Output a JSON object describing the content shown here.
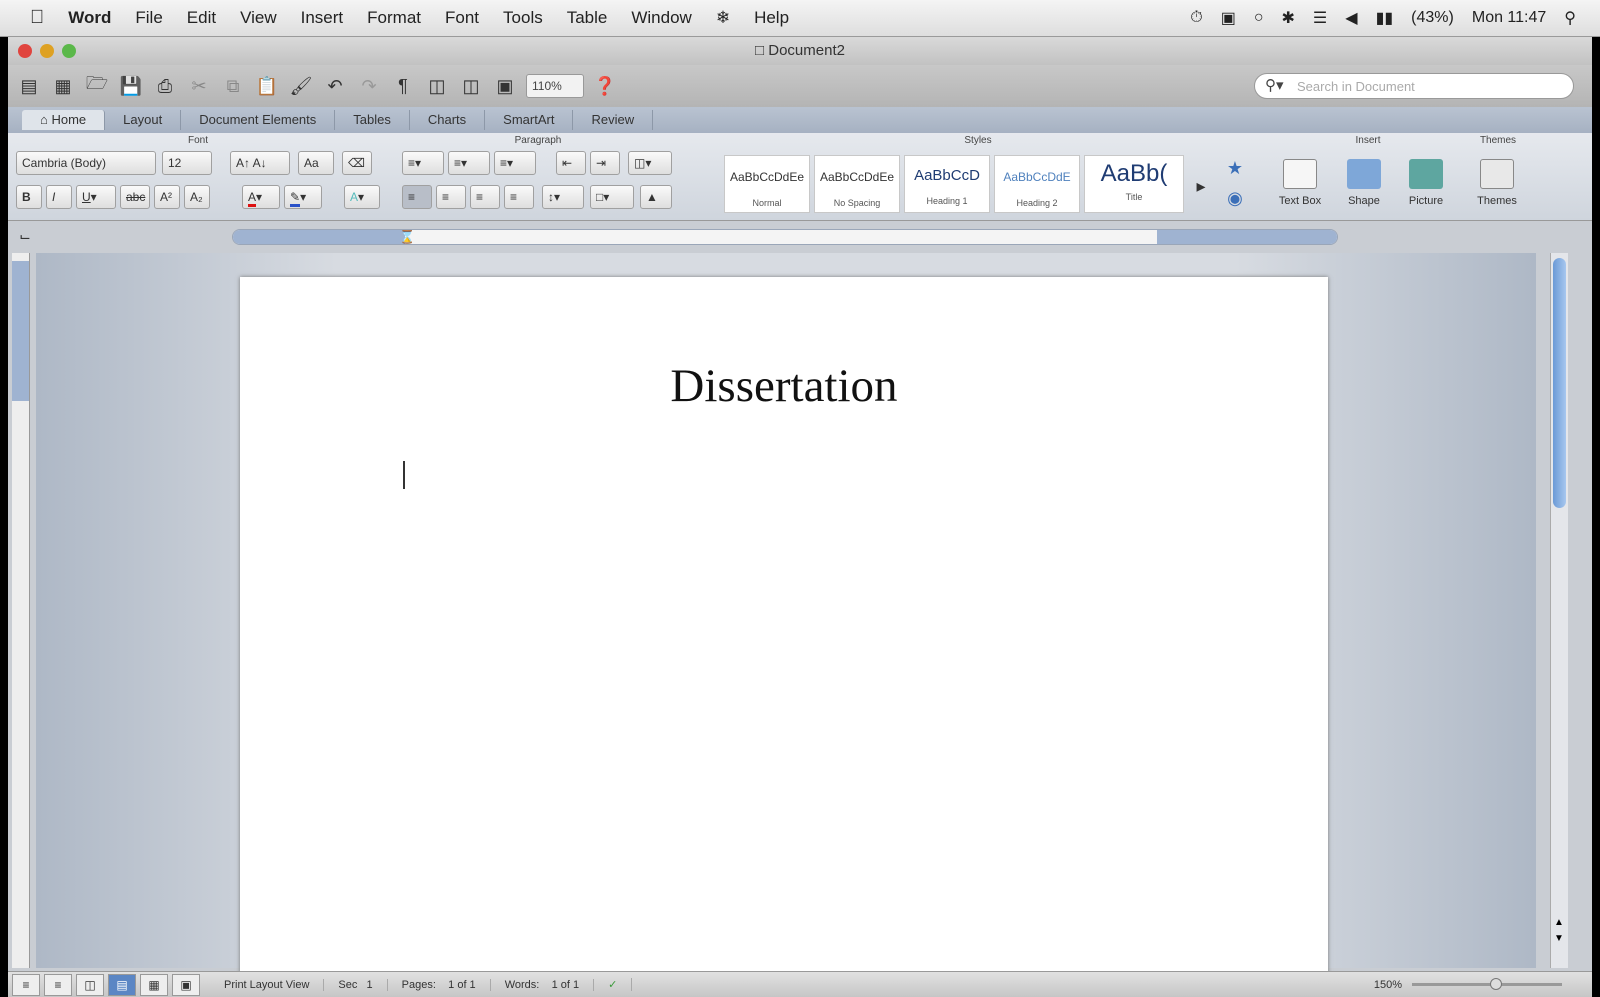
{
  "menubar": {
    "items": [
      "Word",
      "File",
      "Edit",
      "View",
      "Insert",
      "Format",
      "Font",
      "Tools",
      "Table",
      "Window",
      "Help"
    ],
    "clock": "Mon 11:47",
    "battery": "(43%)"
  },
  "window": {
    "title": "Document2",
    "zoom": "110%",
    "search_placeholder": "Search in Document"
  },
  "ribbon": {
    "tabs": [
      "Home",
      "Layout",
      "Document Elements",
      "Tables",
      "Charts",
      "SmartArt",
      "Review"
    ],
    "groups": {
      "font": "Font",
      "paragraph": "Paragraph",
      "styles": "Styles",
      "insert": "Insert",
      "themes": "Themes"
    },
    "font_name": "Cambria (Body)",
    "font_size": "12",
    "styles": [
      {
        "preview": "AaBbCcDdEe",
        "name": "Normal"
      },
      {
        "preview": "AaBbCcDdEe",
        "name": "No Spacing"
      },
      {
        "preview": "AaBbCcD",
        "name": "Heading 1"
      },
      {
        "preview": "AaBbCcDdE",
        "name": "Heading 2"
      },
      {
        "preview": "AaBb(",
        "name": "Title"
      }
    ],
    "insert": [
      "Text Box",
      "Shape",
      "Picture",
      "Themes"
    ]
  },
  "document": {
    "title_text": "Dissertation"
  },
  "status": {
    "view": "Print Layout View",
    "sec_label": "Sec",
    "sec_value": "1",
    "pages_label": "Pages:",
    "pages_value": "1 of 1",
    "words_label": "Words:",
    "words_value": "1 of 1",
    "zoom": "150%"
  }
}
